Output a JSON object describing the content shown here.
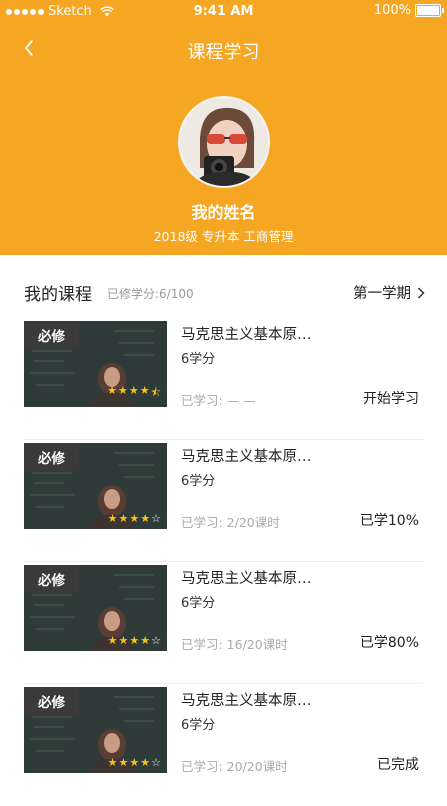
{
  "status_bar": {
    "carrier": "Sketch",
    "time": "9:41 AM",
    "battery": "100%"
  },
  "nav": {
    "title": "课程学习",
    "back_icon": "chevron-left-icon"
  },
  "profile": {
    "name": "我的姓名",
    "info": "2018级  专升本  工商管理"
  },
  "section": {
    "title": "我的课程",
    "credits": "已修学分:6/100",
    "term": "第一学期"
  },
  "courses": [
    {
      "badge": "必修",
      "title": "马克思主义基本原…",
      "credit": "6学分",
      "progress": "已学习: — —",
      "status": "开始学习",
      "rating": 4.5
    },
    {
      "badge": "必修",
      "title": "马克思主义基本原…",
      "credit": "6学分",
      "progress": "已学习: 2/20课时",
      "status": "已学10%",
      "rating": 4
    },
    {
      "badge": "必修",
      "title": "马克思主义基本原…",
      "credit": "6学分",
      "progress": "已学习: 16/20课时",
      "status": "已学80%",
      "rating": 4
    },
    {
      "badge": "必修",
      "title": "马克思主义基本原…",
      "credit": "6学分",
      "progress": "已学习: 20/20课时",
      "status": "已完成",
      "rating": 4
    }
  ],
  "colors": {
    "accent": "#F5A623",
    "star": "#F8C21C"
  }
}
